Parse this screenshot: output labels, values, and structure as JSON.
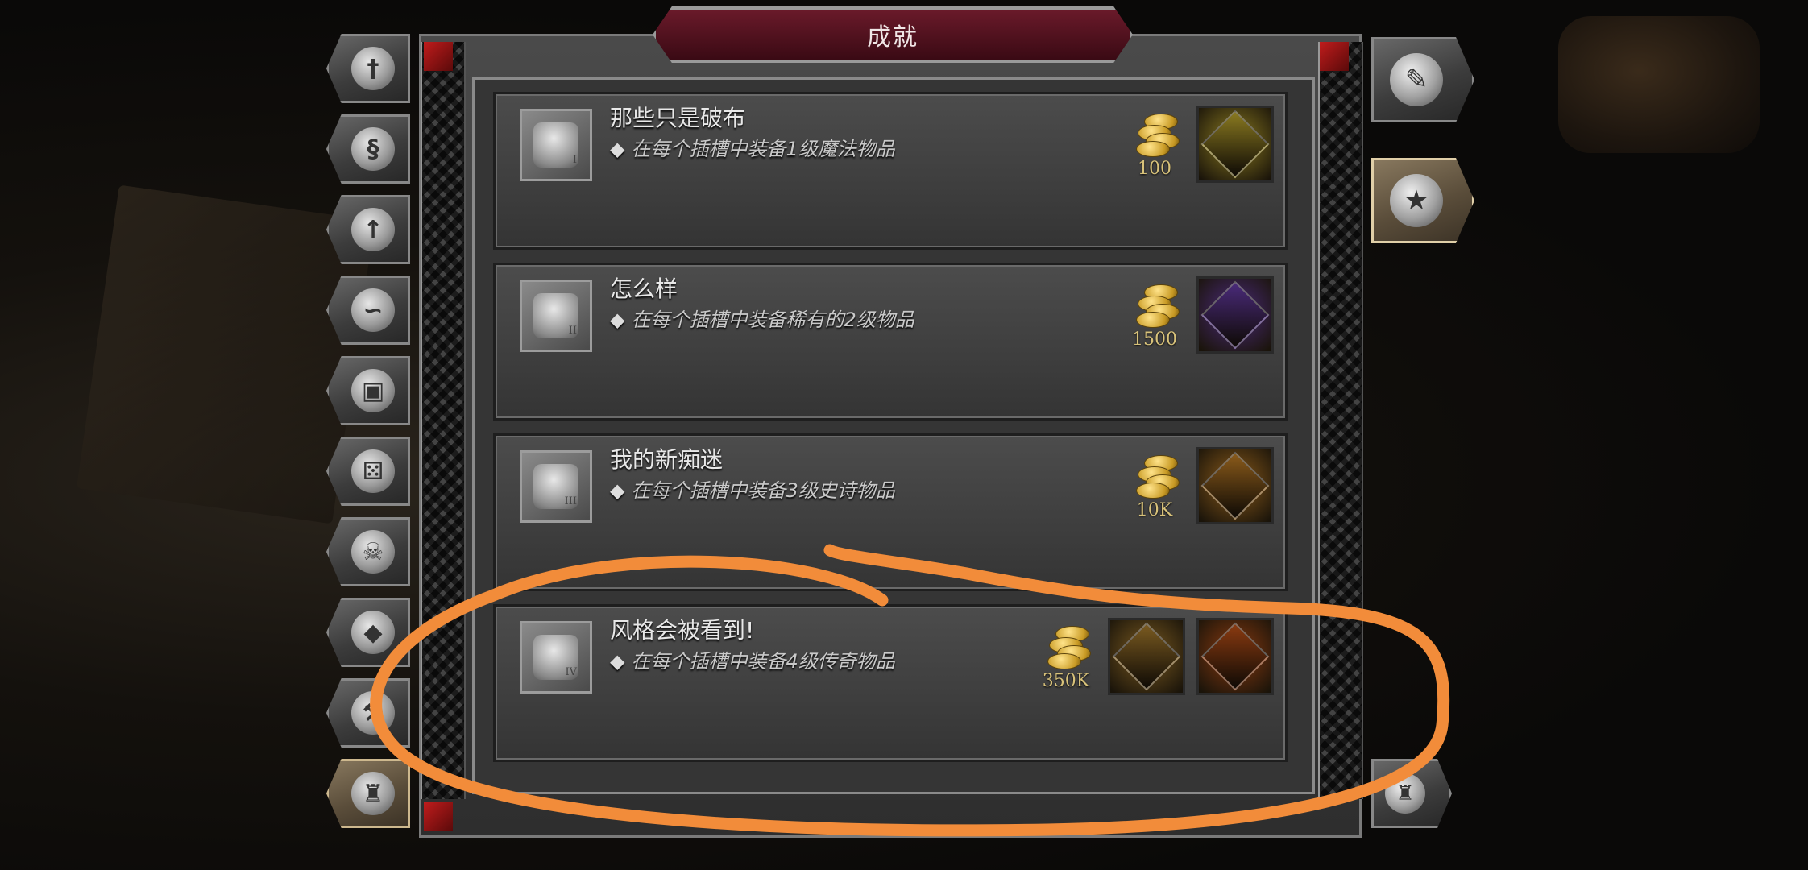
{
  "title": "成就",
  "left_tabs": [
    {
      "icon": "sword-icon",
      "glyph": "†"
    },
    {
      "icon": "scroll-icon",
      "glyph": "§"
    },
    {
      "icon": "wings-upgrade-icon",
      "glyph": "↑"
    },
    {
      "icon": "horn-icon",
      "glyph": "∽"
    },
    {
      "icon": "chest-icon",
      "glyph": "▣"
    },
    {
      "icon": "dice-icon",
      "glyph": "⚄"
    },
    {
      "icon": "demon-skull-icon",
      "glyph": "☠"
    },
    {
      "icon": "gem-icon",
      "glyph": "◆"
    },
    {
      "icon": "hammer-icon",
      "glyph": "⚒"
    },
    {
      "icon": "armor-icon",
      "glyph": "♜"
    }
  ],
  "right_tabs": [
    {
      "icon": "feather-icon",
      "glyph": "✎"
    },
    {
      "icon": "laurel-star-icon",
      "glyph": "★"
    },
    {
      "icon": "armor-stand-icon",
      "glyph": "♜"
    }
  ],
  "achievements": [
    {
      "name": "那些只是破布",
      "description": "在每个插槽中装备1级魔法物品",
      "tier": "I",
      "gold": "100",
      "rewards": [
        {
          "type": "magic-chest",
          "color": "#8a7a20"
        }
      ]
    },
    {
      "name": "怎么样",
      "description": "在每个插槽中装备稀有的2级物品",
      "tier": "II",
      "gold": "1500",
      "rewards": [
        {
          "type": "rare-chest",
          "color": "#4a2a7a"
        }
      ]
    },
    {
      "name": "我的新痴迷",
      "description": "在每个插槽中装备3级史诗物品",
      "tier": "III",
      "gold": "10K",
      "rewards": [
        {
          "type": "epic-chest",
          "color": "#8a5a1a"
        }
      ]
    },
    {
      "name": "风格会被看到!",
      "description": "在每个插槽中装备4级传奇物品",
      "tier": "IV",
      "gold": "350K",
      "rewards": [
        {
          "type": "legendary-chest",
          "color": "#7a5a20"
        },
        {
          "type": "legendary-gem",
          "color": "#8a3a10"
        }
      ]
    }
  ],
  "colors": {
    "annotation": "#f28c3a",
    "title_banner": "#5a1020",
    "gold_text": "#d8c27a"
  }
}
